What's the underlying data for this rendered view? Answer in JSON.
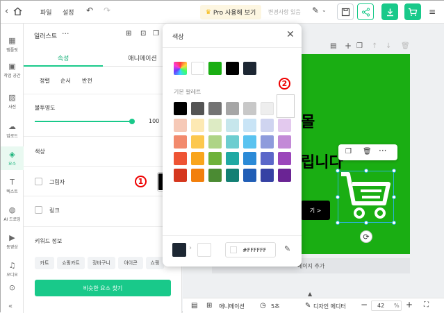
{
  "topbar": {
    "file_label": "파일",
    "settings_label": "설정",
    "pro_label": "Pro 사용해 보기",
    "save_status": "변경사항 있음",
    "colors": {
      "green": "#19c98a"
    }
  },
  "nav": [
    {
      "label": "템플릿",
      "icon": "template-icon",
      "glyph": "▦"
    },
    {
      "label": "작업 공간",
      "icon": "workspace-icon",
      "glyph": "▣"
    },
    {
      "label": "사진",
      "icon": "photo-icon",
      "glyph": "▨"
    },
    {
      "label": "업로드",
      "icon": "upload-icon",
      "glyph": "☁"
    },
    {
      "label": "요소",
      "icon": "elements-icon",
      "glyph": "◈"
    },
    {
      "label": "텍스트",
      "icon": "text-icon",
      "glyph": "T"
    },
    {
      "label": "AI 드로잉",
      "icon": "ai-drawing-icon",
      "glyph": "◍"
    },
    {
      "label": "동영상",
      "icon": "video-icon",
      "glyph": "▶"
    },
    {
      "label": "오디오",
      "icon": "audio-icon",
      "glyph": "♫"
    },
    {
      "label": "",
      "icon": "more-icon",
      "glyph": "⊙"
    }
  ],
  "panel": {
    "title": "일러스트",
    "tabs": [
      "속성",
      "애니메이션"
    ],
    "subtabs": [
      "정렬",
      "순서",
      "반전"
    ],
    "opacity_label": "불투명도",
    "opacity_value": "100",
    "opacity_fraction": 1.0,
    "color_label": "색상",
    "shadow_label": "그림자",
    "link_label": "링크",
    "keyword_label": "키워드 정보",
    "keywords": [
      "카트",
      "쇼핑카트",
      "장바구니",
      "아이콘",
      "쇼핑"
    ],
    "find_button": "비슷한 요소 찾기"
  },
  "popup": {
    "title": "색상",
    "recent_colors": [
      "gradient",
      "#ffffff",
      "#1aae13",
      "#000000",
      "#1d2733"
    ],
    "palette_label": "기본 팔레트",
    "palette": [
      [
        "#000000",
        "#545454",
        "#737373",
        "#a6a6a6",
        "#c8c8c8",
        "#eeeeee",
        "#ffffff"
      ],
      [
        "#f6c9b7",
        "#fde9b3",
        "#ddebc4",
        "#c6e6ec",
        "#c9e4f6",
        "#cfd4f0",
        "#e3c9ee"
      ],
      [
        "#f28a6d",
        "#fcc84e",
        "#aed486",
        "#6ccdd0",
        "#5ac3f0",
        "#8e9bdc",
        "#c38ad7"
      ],
      [
        "#ee5434",
        "#f9a51c",
        "#6eb23a",
        "#20a9a3",
        "#2b8ad7",
        "#5b67c9",
        "#9b46bb"
      ],
      [
        "#d5371e",
        "#f27f0c",
        "#4b8b33",
        "#137f74",
        "#215eb6",
        "#3642a4",
        "#6a2494"
      ]
    ],
    "hex_value": "#FFFFFF",
    "current_color": "#1d2733"
  },
  "canvas": {
    "headline1": "몰",
    "headline2": "립니다",
    "cta_label": "기 >",
    "add_page": "페이지 추가",
    "bg_color": "#1aae13"
  },
  "bottombar": {
    "animation_label": "애니메이션",
    "duration_label": "5초",
    "design_editor_label": "디자인 에디터",
    "zoom_value": "42",
    "zoom_unit": "%"
  },
  "annotations": {
    "one": "1",
    "two": "2"
  }
}
